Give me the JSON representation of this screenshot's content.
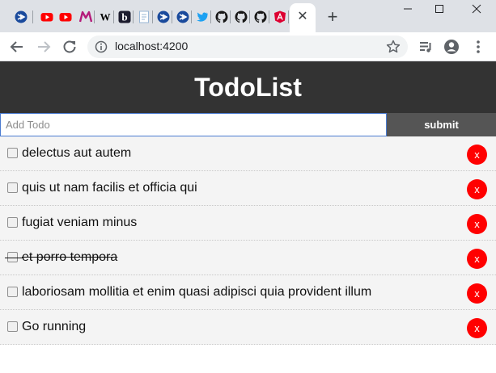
{
  "browser": {
    "tabs": [
      {
        "icon": "chevron-circle-icon",
        "color": "#1a4a9c"
      },
      {
        "icon": "youtube-icon",
        "color": "#ff0000"
      },
      {
        "icon": "youtube-icon",
        "color": "#ff0000"
      },
      {
        "icon": "m-logo-icon",
        "color": "#b41b7a"
      },
      {
        "icon": "wikipedia-icon",
        "glyph": "W",
        "color": "#000000"
      },
      {
        "icon": "b-logo-icon",
        "glyph": "b",
        "color": "#1c1c2e"
      },
      {
        "icon": "document-icon",
        "color": "#9ab7d6"
      },
      {
        "icon": "chevron-circle-icon",
        "color": "#1a4a9c"
      },
      {
        "icon": "chevron-circle-icon",
        "color": "#1a4a9c"
      },
      {
        "icon": "twitter-icon",
        "color": "#1da1f2"
      },
      {
        "icon": "github-icon",
        "color": "#181717"
      },
      {
        "icon": "github-icon",
        "color": "#181717"
      },
      {
        "icon": "github-icon",
        "color": "#181717"
      },
      {
        "icon": "angular-icon",
        "color": "#dd0031"
      }
    ],
    "active_tab_close": "✕",
    "new_tab": "+",
    "url": "localhost:4200"
  },
  "app": {
    "title": "TodoList",
    "input_placeholder": "Add Todo",
    "input_value": "",
    "submit_label": "submit",
    "delete_label": "x",
    "accent_colors": {
      "header": "#333333",
      "submit": "#555555",
      "delete": "#ff0000"
    },
    "todos": [
      {
        "title": "delectus aut autem",
        "completed": false
      },
      {
        "title": "quis ut nam facilis et officia qui",
        "completed": false
      },
      {
        "title": "fugiat veniam minus",
        "completed": false
      },
      {
        "title": "et porro tempora",
        "completed": true
      },
      {
        "title": "laboriosam mollitia et enim quasi adipisci quia provident illum",
        "completed": false
      },
      {
        "title": "Go running",
        "completed": false
      }
    ]
  }
}
